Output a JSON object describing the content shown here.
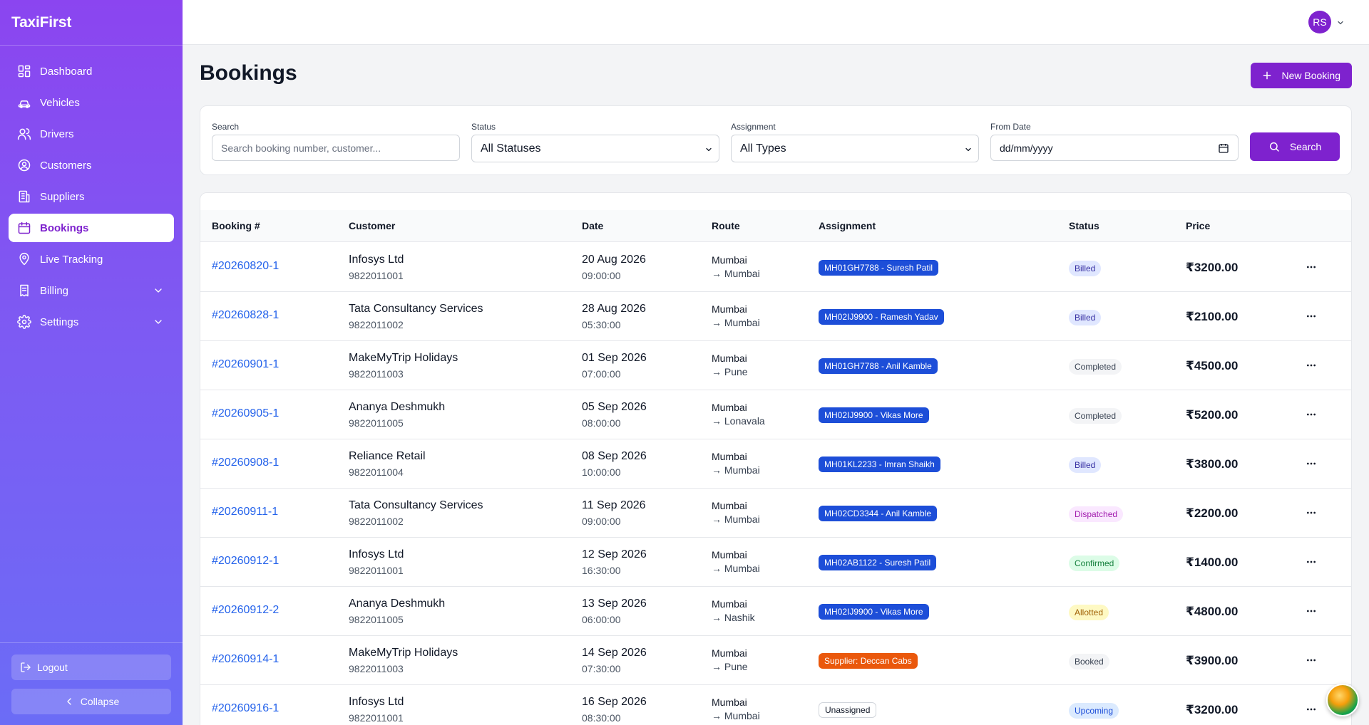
{
  "app": {
    "brand": "TaxiFirst",
    "accent": "#7e22ce"
  },
  "sidebar": {
    "items": [
      {
        "label": "Dashboard",
        "icon": "grid-icon"
      },
      {
        "label": "Vehicles",
        "icon": "car-icon"
      },
      {
        "label": "Drivers",
        "icon": "users-icon"
      },
      {
        "label": "Customers",
        "icon": "user-circle-icon"
      },
      {
        "label": "Suppliers",
        "icon": "building-icon"
      },
      {
        "label": "Bookings",
        "icon": "calendar-icon",
        "active": true
      },
      {
        "label": "Live Tracking",
        "icon": "map-pin-icon"
      },
      {
        "label": "Billing",
        "icon": "receipt-icon",
        "expandable": true
      },
      {
        "label": "Settings",
        "icon": "gear-icon",
        "expandable": true
      }
    ],
    "logout_label": "Logout",
    "collapse_label": "Collapse"
  },
  "topbar": {
    "avatar_initials": "RS"
  },
  "page": {
    "title": "Bookings",
    "new_button_label": "New Booking"
  },
  "filters": {
    "search_label": "Search",
    "search_placeholder": "Search booking number, customer...",
    "status_label": "Status",
    "status_value": "All Statuses",
    "assignment_label": "Assignment",
    "assignment_value": "All Types",
    "from_date_label": "From Date",
    "from_date_value": "dd/mm/yyyy",
    "search_button_label": "Search"
  },
  "table": {
    "headers": [
      "Booking #",
      "Customer",
      "Date",
      "Route",
      "Assignment",
      "Status",
      "Price"
    ],
    "rows": [
      {
        "booking": "#20260820-1",
        "customer": "Infosys Ltd",
        "phone": "9822011001",
        "date": "20 Aug 2026",
        "time": "09:00:00",
        "from": "Mumbai",
        "to": "→ Mumbai",
        "assignment": "MH01GH7788 - Suresh Patil",
        "assign_type": "vehicle",
        "status": "Billed",
        "price": "₹3200.00"
      },
      {
        "booking": "#20260828-1",
        "customer": "Tata Consultancy Services",
        "phone": "9822011002",
        "date": "28 Aug 2026",
        "time": "05:30:00",
        "from": "Mumbai",
        "to": "→ Mumbai",
        "assignment": "MH02IJ9900 - Ramesh Yadav",
        "assign_type": "vehicle",
        "status": "Billed",
        "price": "₹2100.00"
      },
      {
        "booking": "#20260901-1",
        "customer": "MakeMyTrip Holidays",
        "phone": "9822011003",
        "date": "01 Sep 2026",
        "time": "07:00:00",
        "from": "Mumbai",
        "to": "→ Pune",
        "assignment": "MH01GH7788 - Anil Kamble",
        "assign_type": "vehicle",
        "status": "Completed",
        "price": "₹4500.00"
      },
      {
        "booking": "#20260905-1",
        "customer": "Ananya Deshmukh",
        "phone": "9822011005",
        "date": "05 Sep 2026",
        "time": "08:00:00",
        "from": "Mumbai",
        "to": "→ Lonavala",
        "assignment": "MH02IJ9900 - Vikas More",
        "assign_type": "vehicle",
        "status": "Completed",
        "price": "₹5200.00"
      },
      {
        "booking": "#20260908-1",
        "customer": "Reliance Retail",
        "phone": "9822011004",
        "date": "08 Sep 2026",
        "time": "10:00:00",
        "from": "Mumbai",
        "to": "→ Mumbai",
        "assignment": "MH01KL2233 - Imran Shaikh",
        "assign_type": "vehicle",
        "status": "Billed",
        "price": "₹3800.00"
      },
      {
        "booking": "#20260911-1",
        "customer": "Tata Consultancy Services",
        "phone": "9822011002",
        "date": "11 Sep 2026",
        "time": "09:00:00",
        "from": "Mumbai",
        "to": "→ Mumbai",
        "assignment": "MH02CD3344 - Anil Kamble",
        "assign_type": "vehicle",
        "status": "Dispatched",
        "price": "₹2200.00"
      },
      {
        "booking": "#20260912-1",
        "customer": "Infosys Ltd",
        "phone": "9822011001",
        "date": "12 Sep 2026",
        "time": "16:30:00",
        "from": "Mumbai",
        "to": "→ Mumbai",
        "assignment": "MH02AB1122 - Suresh Patil",
        "assign_type": "vehicle",
        "status": "Confirmed",
        "price": "₹1400.00"
      },
      {
        "booking": "#20260912-2",
        "customer": "Ananya Deshmukh",
        "phone": "9822011005",
        "date": "13 Sep 2026",
        "time": "06:00:00",
        "from": "Mumbai",
        "to": "→ Nashik",
        "assignment": "MH02IJ9900 - Vikas More",
        "assign_type": "vehicle",
        "status": "Allotted",
        "price": "₹4800.00"
      },
      {
        "booking": "#20260914-1",
        "customer": "MakeMyTrip Holidays",
        "phone": "9822011003",
        "date": "14 Sep 2026",
        "time": "07:30:00",
        "from": "Mumbai",
        "to": "→ Pune",
        "assignment": "Supplier: Deccan Cabs",
        "assign_type": "supplier",
        "status": "Booked",
        "price": "₹3900.00"
      },
      {
        "booking": "#20260916-1",
        "customer": "Infosys Ltd",
        "phone": "9822011001",
        "date": "16 Sep 2026",
        "time": "08:30:00",
        "from": "Mumbai",
        "to": "→ Mumbai",
        "assignment": "Unassigned",
        "assign_type": "none",
        "status": "Upcoming",
        "price": "₹3200.00"
      }
    ]
  },
  "status_colors": {
    "Billed": {
      "bg": "#e0e7ff",
      "fg": "#3730a3"
    },
    "Completed": {
      "bg": "#f3f4f6",
      "fg": "#374151"
    },
    "Dispatched": {
      "bg": "#fae8ff",
      "fg": "#a21caf"
    },
    "Confirmed": {
      "bg": "#dcfce7",
      "fg": "#15803d"
    },
    "Allotted": {
      "bg": "#fef9c3",
      "fg": "#a16207"
    },
    "Booked": {
      "bg": "#f3f4f6",
      "fg": "#374151"
    },
    "Upcoming": {
      "bg": "#dbeafe",
      "fg": "#1d4ed8"
    }
  }
}
